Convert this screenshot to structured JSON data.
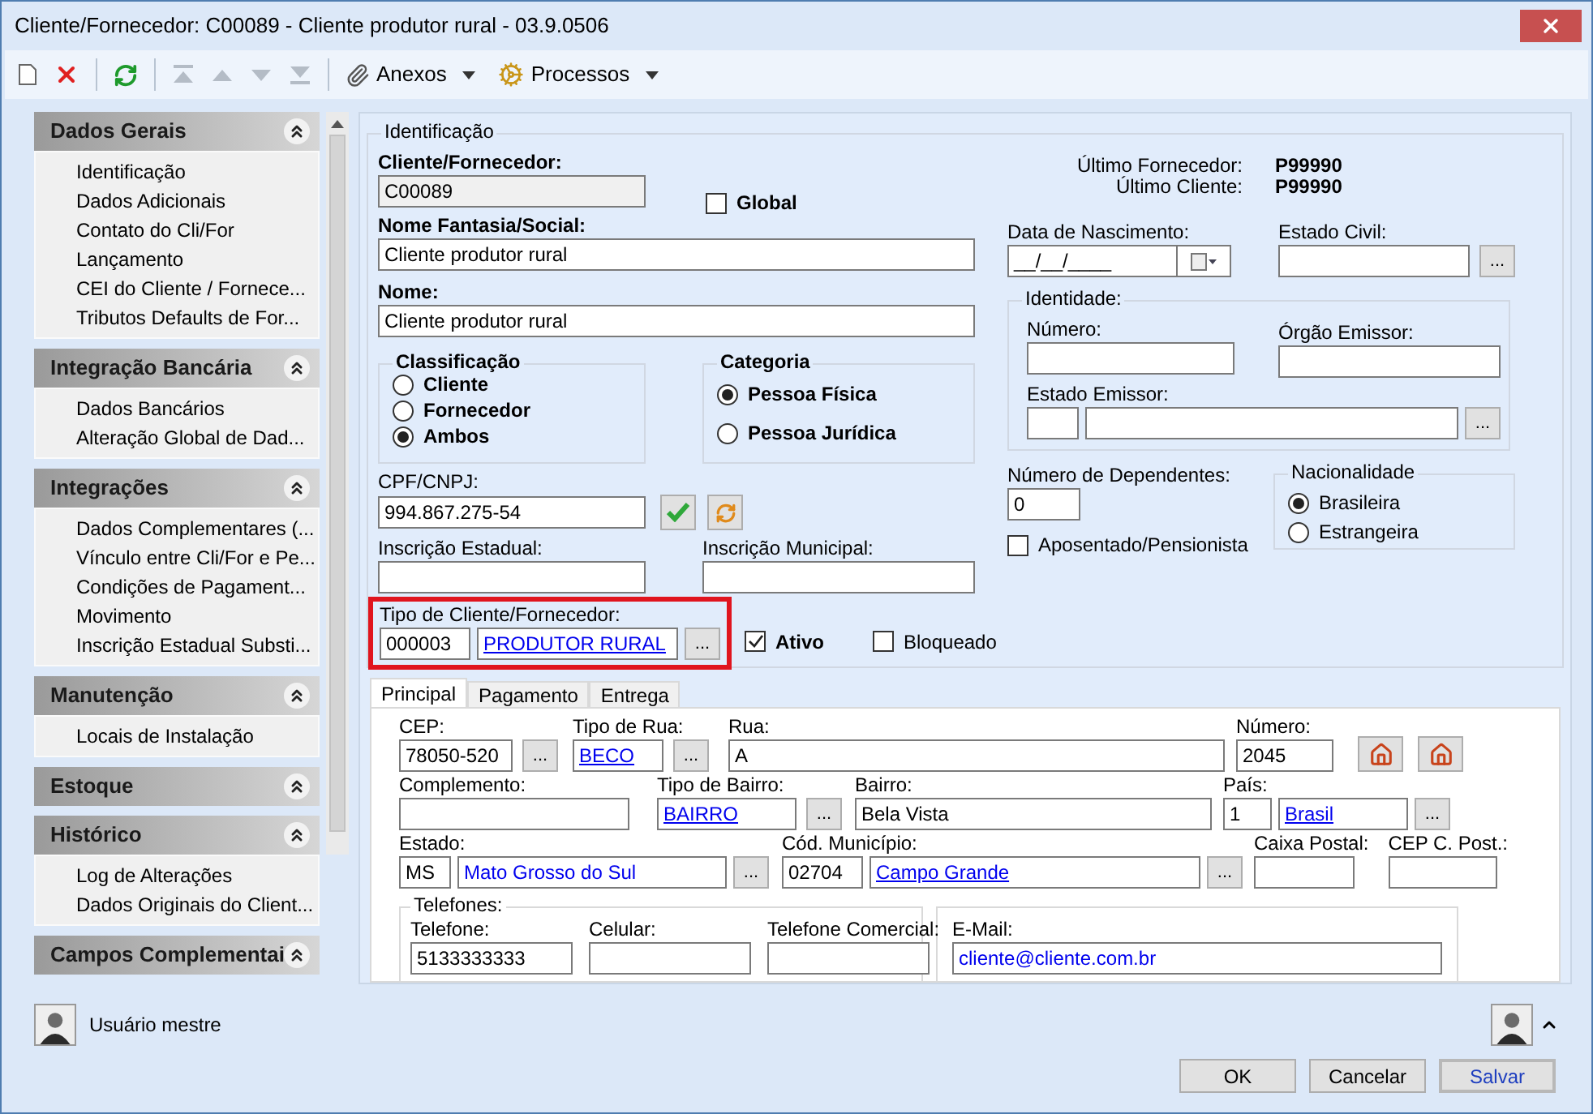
{
  "window": {
    "title": "Cliente/Fornecedor: C00089 - Cliente produtor rural - 03.9.0506"
  },
  "toolbar": {
    "nav": [
      {
        "kind": "first",
        "disabled": true
      },
      {
        "kind": "prev",
        "disabled": true
      },
      {
        "kind": "next",
        "disabled": true
      },
      {
        "kind": "last",
        "disabled": true
      }
    ],
    "menus": [
      {
        "kind": "attach",
        "label": "Anexos"
      },
      {
        "kind": "process",
        "label": "Processos"
      }
    ]
  },
  "sidebar": {
    "sections": [
      {
        "title": "Dados Gerais",
        "items": [
          "Identificação",
          "Dados Adicionais",
          "Contato do Cli/For",
          "Lançamento",
          "CEI do Cliente / Fornece...",
          "Tributos Defaults de For..."
        ]
      },
      {
        "title": "Integração Bancária",
        "items": [
          "Dados Bancários",
          "Alteração Global de Dad..."
        ]
      },
      {
        "title": "Integrações",
        "items": [
          "Dados Complementares (...",
          "Vínculo entre Cli/For e Pe...",
          "Condições de Pagament...",
          "Movimento",
          "Inscrição Estadual Substi..."
        ]
      },
      {
        "title": "Manutenção",
        "items": [
          "Locais de Instalação"
        ]
      },
      {
        "title": "Estoque"
      },
      {
        "title": "Histórico",
        "items": [
          "Log de Alterações",
          "Dados Originais do Client..."
        ]
      },
      {
        "title": "Campos Complementai"
      }
    ]
  },
  "ident": {
    "legend": "Identificação",
    "codigo": {
      "label": "Cliente/Fornecedor:",
      "value": "C00089"
    },
    "global": {
      "label": "Global",
      "checked": false
    },
    "ultimo": [
      {
        "label": "Último Fornecedor:",
        "value": "P99990"
      },
      {
        "label": "Último Cliente:",
        "value": "P99990"
      }
    ],
    "nome_fantasia": {
      "label": "Nome Fantasia/Social:",
      "value": "Cliente produtor rural"
    },
    "nome": {
      "label": "Nome:",
      "value": "Cliente produtor rural"
    },
    "data_nascimento": {
      "label": "Data de Nascimento:",
      "value": "__/__/____"
    },
    "estado_civil": {
      "label": "Estado Civil:",
      "button": "..."
    },
    "classificacao": {
      "legend": "Classificação",
      "options": [
        {
          "label": "Cliente",
          "selected": false
        },
        {
          "label": "Fornecedor",
          "selected": false
        },
        {
          "label": "Ambos",
          "selected": true
        }
      ]
    },
    "categoria": {
      "legend": "Categoria",
      "options": [
        {
          "label": "Pessoa Física",
          "selected": true
        },
        {
          "label": "Pessoa Jurídica",
          "selected": false
        }
      ]
    },
    "identidade": {
      "legend": "Identidade:",
      "numero": {
        "label": "Número:"
      },
      "orgao": {
        "label": "Órgão Emissor:"
      },
      "estado_emissor": {
        "label": "Estado Emissor:",
        "button": "..."
      }
    },
    "cpf": {
      "label": "CPF/CNPJ:",
      "value": "994.867.275-54"
    },
    "dependentes": {
      "label": "Número de Dependentes:",
      "value": "0"
    },
    "aposentado": {
      "label": "Aposentado/Pensionista",
      "checked": false
    },
    "nacionalidade": {
      "legend": "Nacionalidade",
      "options": [
        {
          "label": "Brasileira",
          "selected": true
        },
        {
          "label": "Estrangeira",
          "selected": false
        }
      ]
    },
    "inscricao_estadual": {
      "label": "Inscrição Estadual:"
    },
    "inscricao_municipal": {
      "label": "Inscrição Municipal:"
    },
    "tipo": {
      "label": "Tipo de Cliente/Fornecedor:",
      "code": "000003",
      "value": "PRODUTOR RURAL",
      "button": "...",
      "highlighted": true
    },
    "ativo": {
      "label": "Ativo",
      "checked": true
    },
    "bloqueado": {
      "label": "Bloqueado",
      "checked": false
    }
  },
  "tabs": [
    {
      "label": "Principal",
      "selected": true
    },
    {
      "label": "Pagamento",
      "selected": false
    },
    {
      "label": "Entrega",
      "selected": false
    }
  ],
  "endereco": {
    "cep": {
      "label": "CEP:",
      "value": "78050-520",
      "button": "..."
    },
    "tipo_rua": {
      "label": "Tipo de Rua:",
      "value": "BECO",
      "link": true,
      "button": "..."
    },
    "rua": {
      "label": "Rua:",
      "value": "A"
    },
    "numero": {
      "label": "Número:",
      "value": "2045"
    },
    "complemento": {
      "label": "Complemento:"
    },
    "tipo_bairro": {
      "label": "Tipo de Bairro:",
      "value": "BAIRRO",
      "link": true,
      "button": "..."
    },
    "bairro": {
      "label": "Bairro:",
      "value": "Bela Vista"
    },
    "pais": {
      "label": "País:",
      "code": "1",
      "value": "Brasil",
      "link": true,
      "button": "..."
    },
    "estado": {
      "label": "Estado:",
      "code": "MS",
      "value": "Mato Grosso do Sul",
      "link": false,
      "button": "..."
    },
    "municipio": {
      "label": "Cód. Município:",
      "code": "02704",
      "value": "Campo Grande",
      "link": true,
      "button": "..."
    },
    "caixa_postal": {
      "label": "Caixa Postal:"
    },
    "cep_caixa": {
      "label": "CEP C. Post.:"
    }
  },
  "telefones": {
    "legend": "Telefones:",
    "fields": [
      {
        "label": "Telefone:",
        "value": "5133333333"
      },
      {
        "label": "Celular:"
      },
      {
        "label": "Telefone Comercial:"
      }
    ]
  },
  "email": {
    "label": "E-Mail:",
    "value": "cliente@cliente.com.br"
  },
  "user": {
    "name": "Usuário mestre"
  },
  "buttons": [
    {
      "label": "OK",
      "default": false
    },
    {
      "label": "Cancelar",
      "default": false
    },
    {
      "label": "Salvar",
      "default": true
    }
  ]
}
